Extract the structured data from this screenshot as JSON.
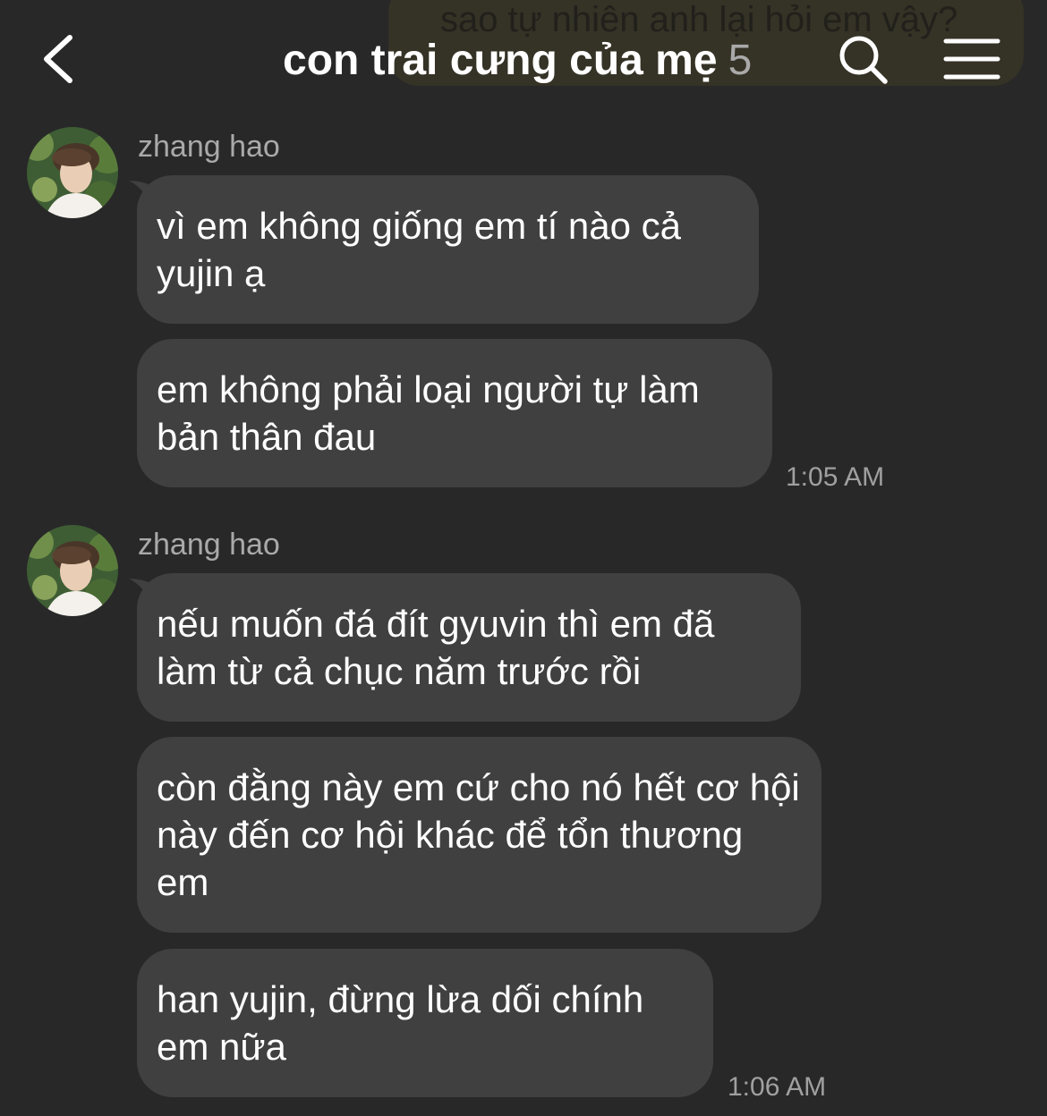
{
  "header": {
    "ghost_message": "sao tự nhiên anh lại hỏi em vậy?",
    "title": "con trai cưng của mẹ",
    "member_count": "5"
  },
  "groups": [
    {
      "sender": "zhang hao",
      "messages": [
        "vì em không giống em tí nào cả yujin ạ",
        "em không phải loại người tự làm bản thân đau"
      ],
      "time": "1:05 AM"
    },
    {
      "sender": "zhang hao",
      "messages": [
        "nếu muốn đá đít gyuvin thì em đã làm từ cả chục năm trước rồi",
        "còn đằng này em cứ cho nó hết cơ hội này đến cơ hội khác để tổn thương em",
        "han yujin, đừng lừa dối chính em nữa"
      ],
      "time": "1:06 AM"
    }
  ],
  "colors": {
    "background": "#282828",
    "bubble": "#404040",
    "secondary_text": "#a9a9a9"
  },
  "icons": {
    "back": "chevron-left-icon",
    "search": "search-icon",
    "menu": "hamburger-menu-icon"
  }
}
